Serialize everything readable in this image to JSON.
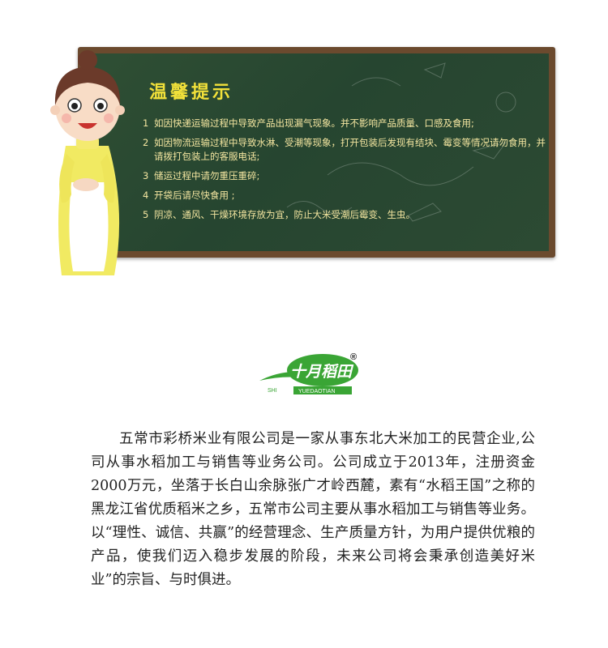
{
  "notice": {
    "title": "温馨提示",
    "tips": [
      {
        "num": "1",
        "text": "如因快递运输过程中导致产品出现漏气现象。并不影响产品质量、口感及食用;"
      },
      {
        "num": "2",
        "text": "如因物流运输过程中导致水淋、受潮等现象，打开包装后发现有结块、霉变等情况请勿食用，并请拨打包装上的客服电话;"
      },
      {
        "num": "3",
        "text": "储运过程中请勿重压重碎;"
      },
      {
        "num": "4",
        "text": "开袋后请尽快食用 ;"
      },
      {
        "num": "5",
        "text": "阴凉、通风、干燥环境存放为宜，防止大米受潮后霉变、生虫。"
      }
    ]
  },
  "brand": {
    "logo_text": "十月稻田",
    "registered_mark": "®",
    "sub_shi": "SHI",
    "sub_yuedaotian": "YUEDAOTIAN",
    "color": "#3aa535"
  },
  "intro": {
    "paragraph": "五常市彩桥米业有限公司是一家从事东北大米加工的民营企业,公司从事水稻加工与销售等业务公司。公司成立于2013年，注册资金2000万元，坐落于长白山余脉张广才岭西麓，素有“水稻王国”之称的黑龙江省优质稻米之乡，五常市公司主要从事水稻加工与销售等业务。以“理性、诚信、共赢”的经营理念、生产质量方针，为用户提供优粮的产品，使我们迈入稳步发展的阶段，未来公司将会秉承创造美好米业”的宗旨、与时俱进。"
  }
}
